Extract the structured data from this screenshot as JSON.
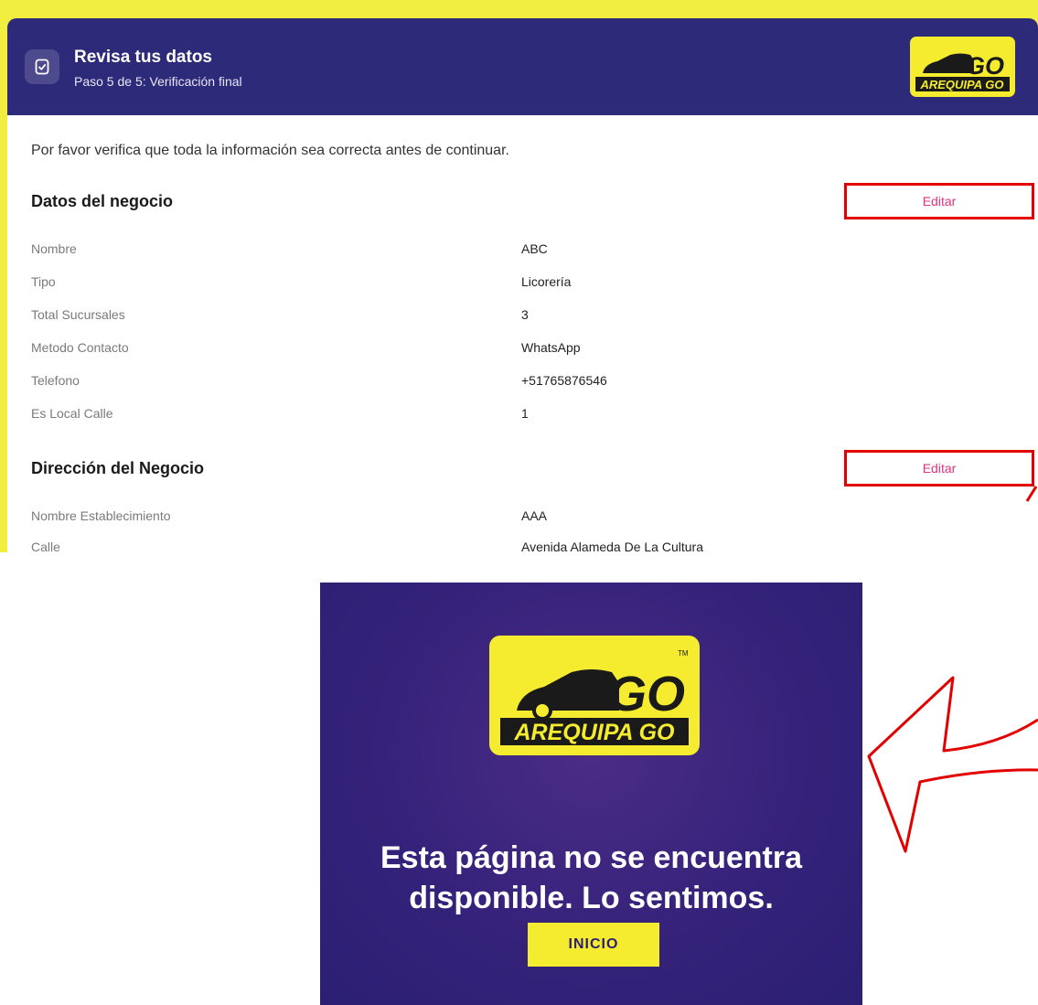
{
  "header": {
    "title": "Revisa tus datos",
    "subtitle": "Paso 5 de 5: Verificación final",
    "logo_mark": "GO",
    "logo_word": "AREQUIPA GO"
  },
  "intro": "Por favor verifica que toda la información sea correcta antes de continuar.",
  "sections": [
    {
      "title": "Datos del negocio",
      "edit_label": "Editar",
      "fields": [
        {
          "label": "Nombre",
          "value": "ABC"
        },
        {
          "label": "Tipo",
          "value": "Licorería"
        },
        {
          "label": "Total Sucursales",
          "value": "3"
        },
        {
          "label": "Metodo Contacto",
          "value": "WhatsApp"
        },
        {
          "label": "Telefono",
          "value": "+51765876546"
        },
        {
          "label": "Es Local Calle",
          "value": "1"
        }
      ]
    },
    {
      "title": "Dirección del Negocio",
      "edit_label": "Editar",
      "fields": [
        {
          "label": "Nombre Establecimiento",
          "value": "AAA"
        },
        {
          "label": "Calle",
          "value": "Avenida Alameda De La Cultura"
        }
      ]
    }
  ],
  "error_page": {
    "logo_mark": "GO",
    "logo_word": "AREQUIPA GO",
    "trademark": "TM",
    "message_line1": "Esta página no se encuentra",
    "message_line2": "disponible. Lo sentimos.",
    "button_label": "INICIO"
  },
  "colors": {
    "frame_yellow": "#f1ee3f",
    "header_purple": "#2e2a7a",
    "edit_pink": "#e0337a",
    "annotation_red": "#e20000",
    "button_yellow": "#f5ec2f"
  }
}
